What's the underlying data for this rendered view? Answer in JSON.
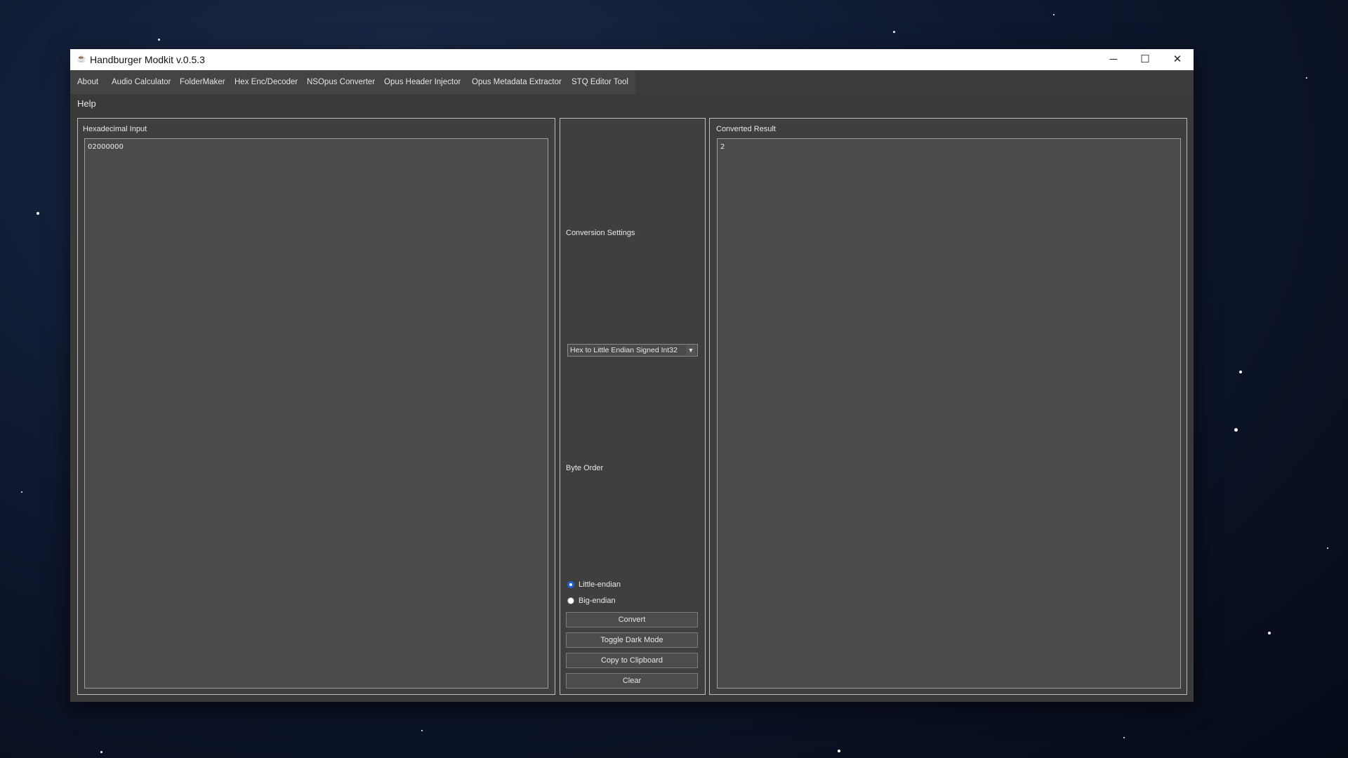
{
  "window": {
    "title": "Handburger Modkit v.0.5.3"
  },
  "window_controls": {
    "minimize": "─",
    "maximize": "☐",
    "close": "✕"
  },
  "menu": {
    "items": [
      {
        "label": "About"
      },
      {
        "label": "Audio Calculator"
      },
      {
        "label": "FolderMaker"
      },
      {
        "label": "Hex Enc/Decoder"
      },
      {
        "label": "NSOpus Converter"
      },
      {
        "label": "Opus Header Injector"
      },
      {
        "label": "Opus Metadata Extractor"
      },
      {
        "label": "STQ Editor Tool"
      }
    ],
    "help": "Help"
  },
  "input_panel": {
    "title": "Hexadecimal Input",
    "value": "02000000"
  },
  "settings_panel": {
    "conversion_label": "Conversion Settings",
    "conversion_selected": "Hex to Little Endian Signed Int32",
    "byte_order_label": "Byte Order",
    "radios": [
      {
        "label": "Little-endian",
        "checked": true
      },
      {
        "label": "Big-endian",
        "checked": false
      }
    ],
    "buttons": {
      "convert": "Convert",
      "toggle_dark": "Toggle Dark Mode",
      "copy": "Copy to Clipboard",
      "clear": "Clear"
    }
  },
  "result_panel": {
    "title": "Converted Result",
    "value": "2"
  },
  "colors": {
    "radio_accent": "#1e63d6",
    "window_bg": "#3a3a3a"
  }
}
